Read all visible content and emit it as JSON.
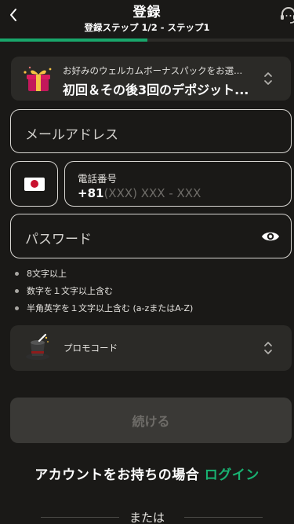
{
  "header": {
    "title": "登録",
    "subtitle": "登録ステップ 1/2 - ステップ1",
    "progress_fraction": 0.5
  },
  "bonus": {
    "prompt": "お好みのウェルカムボーナスパックをお選...",
    "selected": "初回＆その後3回のデポジット..."
  },
  "form": {
    "email_placeholder": "メールアドレス",
    "phone_label": "電話番号",
    "phone_country_code": "+81",
    "phone_mask": "(XXX) XXX - XXX",
    "phone_country_flag": "japan-flag",
    "password_placeholder": "パスワード"
  },
  "password_rules": [
    "8文字以上",
    "数字を１文字以上含む",
    "半角英字を１文字以上含む (a-zまたはA-Z)"
  ],
  "promo": {
    "label": "プロモコード"
  },
  "continue_label": "続ける",
  "login": {
    "prompt": "アカウントをお持ちの場合",
    "link": "ログイン"
  },
  "or_label": "または",
  "colors": {
    "background": "#1a1917",
    "accent": "#19b272",
    "card": "#2b2a27"
  }
}
